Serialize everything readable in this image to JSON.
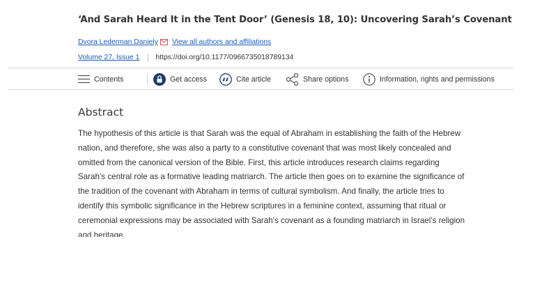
{
  "article": {
    "title": "‘And Sarah Heard It in the Tent Door’ (Genesis 18, 10): Uncovering Sarah’s Covenant",
    "author": "Dvora Lederman Daniely",
    "authors_link": "View all authors and affiliations",
    "volume_issue": "Volume 27, Issue 1",
    "doi": "https://doi.org/10.1177/0966735018789134"
  },
  "toolbar": {
    "contents": "Contents",
    "get_access": "Get access",
    "cite": "Cite article",
    "share": "Share options",
    "info": "Information, rights and permissions"
  },
  "abstract": {
    "heading": "Abstract",
    "lines": [
      "The hypothesis of this article is that Sarah was the equal of Abraham in establishing the faith of the Hebrew",
      "nation, and therefore, she was also a party to a constitutive covenant that was most likely concealed and",
      "omitted from the canonical version of the Bible. First, this article introduces research claims regarding",
      "Sarah’s central role as a formative leading matriarch. The article then goes on to examine the significance of",
      "the tradition of the covenant with Abraham in terms of cultural symbolism. And finally, the article tries to",
      "identify this symbolic significance in the Hebrew scriptures in a feminine context, assuming that ritual or",
      "ceremonial expressions may be associated with Sarah’s covenant as a founding matriarch in Israel’s religion",
      "and heritage."
    ]
  },
  "icons": {
    "mail": "mail-icon",
    "contents": "list-icon",
    "access": "lock-icon",
    "cite": "quote-icon",
    "share": "share-icon",
    "info": "info-icon"
  },
  "colors": {
    "link": "#1a5db8",
    "access_icon": "#1f3a6e",
    "text": "#333333"
  }
}
